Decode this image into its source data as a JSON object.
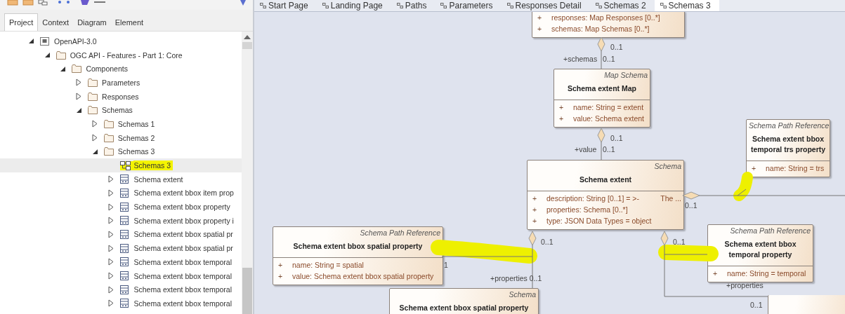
{
  "explorer_tabs": [
    {
      "label": "Project",
      "selected": true
    },
    {
      "label": "Context",
      "selected": false
    },
    {
      "label": "Diagram",
      "selected": false
    },
    {
      "label": "Element",
      "selected": false
    }
  ],
  "tree": [
    {
      "label": "OpenAPI-3.0",
      "kind": "model",
      "expanded": true,
      "selected": false,
      "children": [
        {
          "label": "OGC API - Features - Part 1: Core",
          "kind": "package",
          "expanded": true,
          "selected": false,
          "children": [
            {
              "label": "Components",
              "kind": "package",
              "expanded": true,
              "selected": false,
              "children": [
                {
                  "label": "Parameters",
                  "kind": "package",
                  "expanded": false,
                  "selected": false
                },
                {
                  "label": "Responses",
                  "kind": "package",
                  "expanded": false,
                  "selected": false
                },
                {
                  "label": "Schemas",
                  "kind": "package",
                  "expanded": true,
                  "selected": false,
                  "children": [
                    {
                      "label": "Schemas 1",
                      "kind": "package",
                      "expanded": false,
                      "selected": false
                    },
                    {
                      "label": "Schemas 2",
                      "kind": "package",
                      "expanded": false,
                      "selected": false
                    },
                    {
                      "label": "Schemas 3",
                      "kind": "package",
                      "expanded": true,
                      "selected": false,
                      "children": [
                        {
                          "label": "Schemas 3",
                          "kind": "diagram",
                          "selected": true
                        },
                        {
                          "label": "Schema extent",
                          "kind": "class",
                          "expanded": false,
                          "selected": false
                        },
                        {
                          "label": "Schema extent bbox item prop",
                          "kind": "class",
                          "expanded": false,
                          "selected": false
                        },
                        {
                          "label": "Schema extent bbox property",
                          "kind": "class",
                          "expanded": false,
                          "selected": false
                        },
                        {
                          "label": "Schema extent bbox property i",
                          "kind": "class",
                          "expanded": false,
                          "selected": false
                        },
                        {
                          "label": "Schema extent bbox spatial pr",
                          "kind": "class",
                          "expanded": false,
                          "selected": false
                        },
                        {
                          "label": "Schema extent bbox spatial pr",
                          "kind": "class",
                          "expanded": false,
                          "selected": false
                        },
                        {
                          "label": "Schema extent bbox temporal",
                          "kind": "class",
                          "expanded": false,
                          "selected": false
                        },
                        {
                          "label": "Schema extent bbox temporal",
                          "kind": "class",
                          "expanded": false,
                          "selected": false
                        },
                        {
                          "label": "Schema extent bbox temporal",
                          "kind": "class",
                          "expanded": false,
                          "selected": false
                        },
                        {
                          "label": "Schema extent bbox temporal",
                          "kind": "class",
                          "expanded": false,
                          "selected": false
                        }
                      ]
                    }
                  ]
                }
              ]
            }
          ]
        }
      ]
    }
  ],
  "diagram_tabs": [
    {
      "label": "Start Page",
      "selected": false
    },
    {
      "label": "Landing Page",
      "selected": false
    },
    {
      "label": "Paths",
      "selected": false
    },
    {
      "label": "Parameters",
      "selected": false
    },
    {
      "label": "Responses Detail",
      "selected": false
    },
    {
      "label": "Schemas 2",
      "selected": false
    },
    {
      "label": "Schemas 3",
      "selected": true
    }
  ],
  "diagram": {
    "classes": [
      {
        "kind": "class",
        "attributes": [
          {
            "visibility": "+",
            "text": "responses: Map Responses [0..*]"
          },
          {
            "visibility": "+",
            "text": "schemas: Map Schemas [0..*]"
          }
        ]
      },
      {
        "kind": "class",
        "stereotype": "Map Schema",
        "name": "Schema extent Map",
        "attributes": [
          {
            "visibility": "+",
            "text": "name: String = extent"
          },
          {
            "visibility": "+",
            "text": "value: Schema extent"
          }
        ]
      },
      {
        "kind": "class",
        "stereotype": "Schema",
        "name": "Schema extent",
        "attributes": [
          {
            "visibility": "+",
            "text": "description: String [0..1] = >-",
            "note": "The ..."
          },
          {
            "visibility": "+",
            "text": "properties: Schema [0..*]"
          },
          {
            "visibility": "+",
            "text": "type: JSON Data Types = object"
          }
        ]
      },
      {
        "kind": "class",
        "stereotype": "Schema Path Reference",
        "name": "Schema extent bbox temporal trs property",
        "attributes": [
          {
            "visibility": "+",
            "text": "name: String = trs"
          }
        ]
      },
      {
        "kind": "class",
        "stereotype": "Schema Path Reference",
        "name": "Schema extent bbox spatial property",
        "attributes": [
          {
            "visibility": "+",
            "text": "name: String = spatial"
          },
          {
            "visibility": "+",
            "text": "value: Schema extent bbox spatial property"
          }
        ]
      },
      {
        "kind": "class",
        "stereotype": "Schema Path Reference",
        "name": "Schema extent bbox temporal property",
        "attributes": [
          {
            "visibility": "+",
            "text": "name: String = temporal"
          }
        ]
      },
      {
        "kind": "class",
        "stereotype": "Schema",
        "name": "Schema extent bbox spatial property"
      },
      {
        "kind": "class"
      }
    ],
    "labels": [
      "0..1",
      "+schemas",
      "0..1",
      "0..1",
      "+value",
      "0..1",
      "0..1",
      "0..1",
      "0..1",
      "1",
      "+properties 0..1",
      "+properties",
      "0..1"
    ]
  }
}
